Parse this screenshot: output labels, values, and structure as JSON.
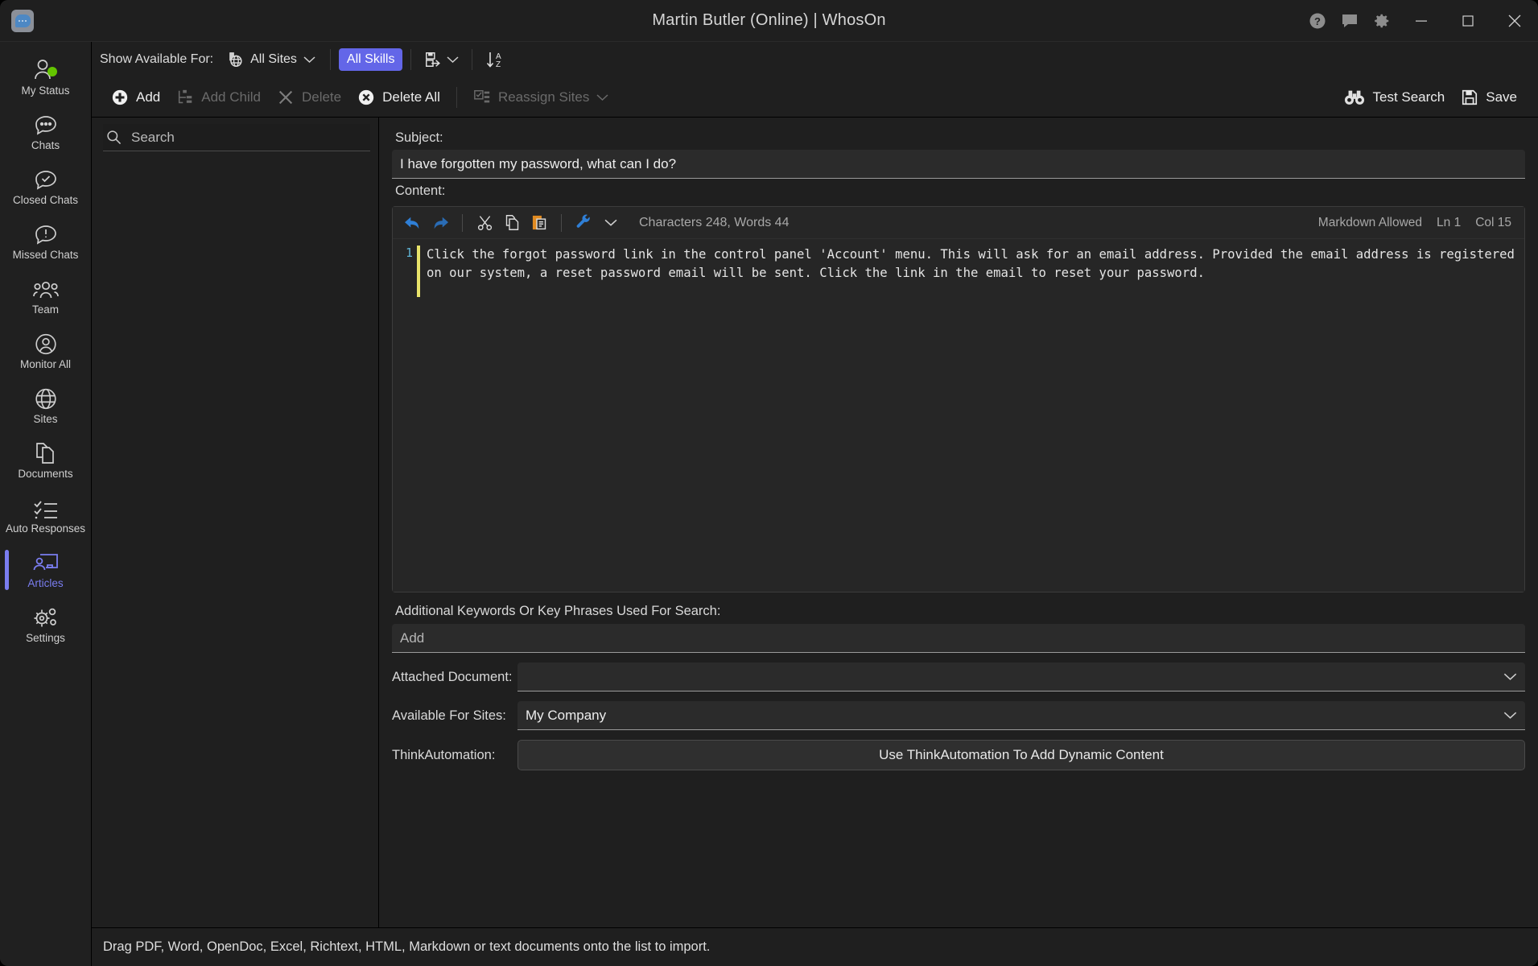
{
  "window": {
    "title": "Martin Butler (Online)  | WhosOn",
    "app_icon": "chat-bubble-logo-icon",
    "titlebar_icons": [
      "help-icon",
      "feedback-icon",
      "settings-gear-icon"
    ],
    "minimize": "—",
    "maximize": "□",
    "close": "✕"
  },
  "sidebar": {
    "items": [
      {
        "label": "My Status",
        "icon": "user-status-icon",
        "active": false,
        "status": "online"
      },
      {
        "label": "Chats",
        "icon": "chat-bubble-icon",
        "active": false
      },
      {
        "label": "Closed Chats",
        "icon": "chat-check-icon",
        "active": false
      },
      {
        "label": "Missed Chats",
        "icon": "chat-alert-icon",
        "active": false
      },
      {
        "label": "Team",
        "icon": "people-group-icon",
        "active": false
      },
      {
        "label": "Monitor All",
        "icon": "user-circle-icon",
        "active": false
      },
      {
        "label": "Sites",
        "icon": "globe-icon",
        "active": false
      },
      {
        "label": "Documents",
        "icon": "documents-copy-icon",
        "active": false
      },
      {
        "label": "Auto Responses",
        "icon": "checklist-icon",
        "active": false
      },
      {
        "label": "Articles",
        "icon": "article-presenter-icon",
        "active": true
      },
      {
        "label": "Settings",
        "icon": "gears-icon",
        "active": false
      }
    ],
    "accent_color": "#7a7df0",
    "status_color": "#63c400"
  },
  "toolbar_filters": {
    "show_available_label": "Show Available For:",
    "sites_dropdown": {
      "label": "All Sites",
      "icon": "sites-globe-icon",
      "chevron": "chevron-down-icon"
    },
    "skills_pill": {
      "label": "All Skills",
      "color": "#6366e8"
    },
    "import_button": {
      "icon": "import-export-icon",
      "chevron": "chevron-down-icon"
    },
    "sort_button": {
      "icon": "sort-az-icon"
    }
  },
  "toolbar_commands": {
    "left": [
      {
        "label": "Add",
        "icon": "plus-circle-icon",
        "disabled": false
      },
      {
        "label": "Add Child",
        "icon": "add-child-node-icon",
        "disabled": true
      },
      {
        "label": "Delete",
        "icon": "cross-icon",
        "disabled": true
      },
      {
        "label": "Delete All",
        "icon": "delete-all-circle-icon",
        "disabled": false
      },
      {
        "label": "Reassign Sites",
        "icon": "reassign-sites-icon",
        "disabled": true,
        "chevron": "chevron-down-icon"
      }
    ],
    "right": [
      {
        "label": "Test Search",
        "icon": "binoculars-icon",
        "disabled": false
      },
      {
        "label": "Save",
        "icon": "floppy-save-icon",
        "disabled": false
      }
    ]
  },
  "list_pane": {
    "search": {
      "placeholder": "Search",
      "value": "",
      "icon": "search-icon"
    },
    "items": []
  },
  "editor": {
    "subject_label": "Subject:",
    "subject_value": "I have forgotten my password, what can I do?",
    "content_label": "Content:",
    "toolbar": {
      "undo": "undo-arrow-icon",
      "redo": "redo-arrow-icon",
      "cut": "scissors-cut-icon",
      "copy": "copy-icon",
      "paste": "paste-clipboard-icon",
      "tools": "wrench-tools-icon",
      "tools_chevron": "chevron-down-icon",
      "stats": "Characters 248, Words 44",
      "markdown": "Markdown Allowed",
      "line": "Ln 1",
      "column": "Col 15"
    },
    "line_number": "1",
    "content_text": "Click the forgot password link in the control panel 'Account' menu. This will ask for an email address. Provided the email address is registered on our system, a reset password email will be sent. Click the link in the email to reset your password."
  },
  "keywords": {
    "label": "Additional Keywords Or Key Phrases Used For Search:",
    "placeholder": "Add",
    "value": ""
  },
  "fields": {
    "attached_document": {
      "label": "Attached Document:",
      "value": "",
      "chevron": "chevron-down-icon"
    },
    "available_for_sites": {
      "label": "Available For Sites:",
      "value": "My Company",
      "chevron": "chevron-down-icon"
    },
    "think_automation": {
      "label": "ThinkAutomation:",
      "button_label": "Use ThinkAutomation To Add Dynamic Content"
    }
  },
  "status_bar": {
    "text": "Drag PDF, Word, OpenDoc, Excel, Richtext, HTML, Markdown or text documents onto the list to import."
  }
}
